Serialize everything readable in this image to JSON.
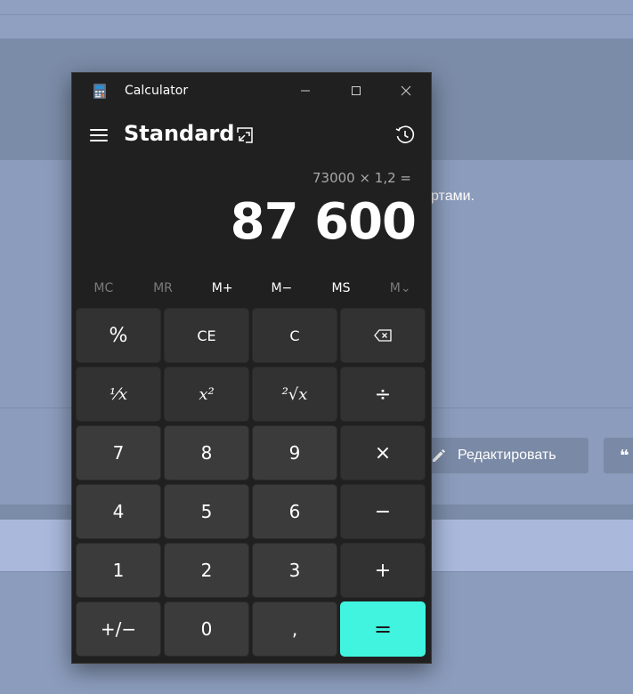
{
  "background": {
    "snippet_text": "ртами.",
    "edit_button_label": "Редактировать",
    "quote_button_label": "❝"
  },
  "window": {
    "title": "Calculator",
    "minimize_glyph": "—",
    "maximize_glyph": "☐",
    "close_glyph": "✕"
  },
  "calculator": {
    "mode": "Standard",
    "expression": "73000 × 1,2 =",
    "result": "87 600",
    "memory": [
      {
        "label": "MC",
        "enabled": false
      },
      {
        "label": "MR",
        "enabled": false
      },
      {
        "label": "M+",
        "enabled": true
      },
      {
        "label": "M−",
        "enabled": true
      },
      {
        "label": "MS",
        "enabled": true
      },
      {
        "label": "M⌄",
        "enabled": false
      }
    ],
    "keys": {
      "percent": "%",
      "ce": "CE",
      "c": "C",
      "backspace": "⌫",
      "reciprocal": "⅟x",
      "square": "x²",
      "sqrt": "²√x",
      "divide": "÷",
      "seven": "7",
      "eight": "8",
      "nine": "9",
      "multiply": "×",
      "four": "4",
      "five": "5",
      "six": "6",
      "minus": "−",
      "one": "1",
      "two": "2",
      "three": "3",
      "plus": "+",
      "negate": "+/−",
      "zero": "0",
      "decimal": ",",
      "equals": "="
    }
  },
  "colors": {
    "accent": "#40f4df",
    "window_bg": "#202020",
    "key_bg": "#323232",
    "num_key_bg": "#3b3b3b"
  }
}
